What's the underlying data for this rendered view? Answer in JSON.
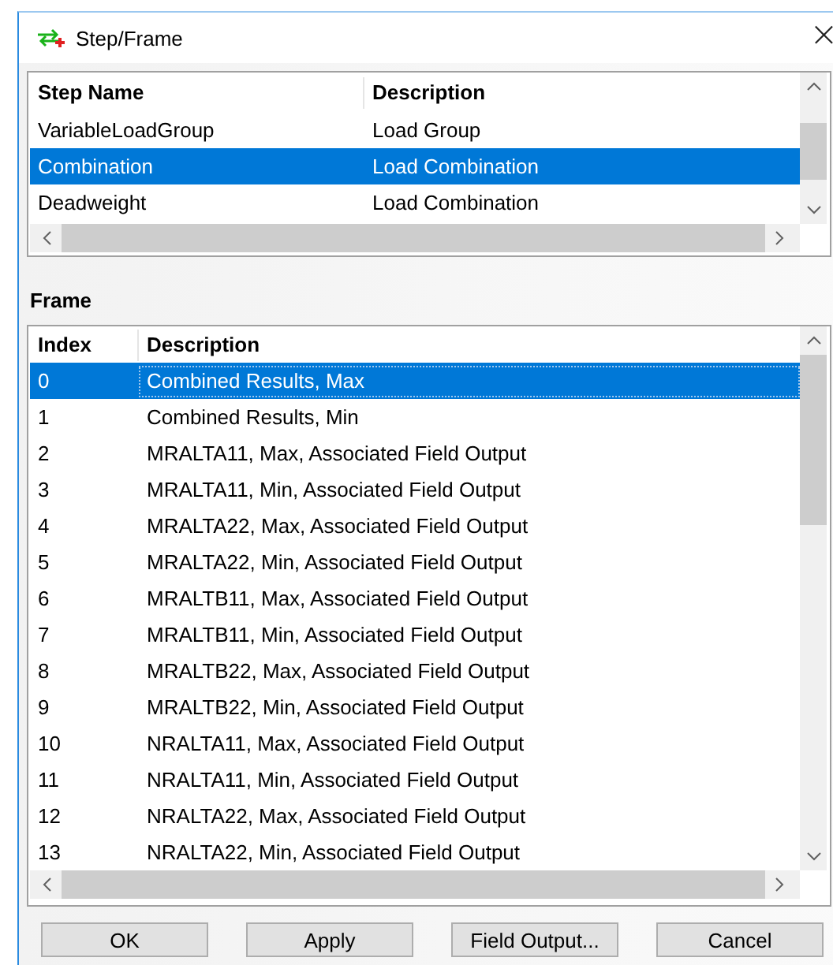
{
  "window": {
    "title": "Step/Frame",
    "close": "×"
  },
  "step_table": {
    "columns": [
      "Step Name",
      "Description"
    ],
    "rows": [
      {
        "cells": [
          "VariableLoadGroup",
          "Load Group"
        ],
        "selected": false
      },
      {
        "cells": [
          "Combination",
          "Load Combination"
        ],
        "selected": true
      },
      {
        "cells": [
          "Deadweight",
          "Load Combination"
        ],
        "selected": false
      }
    ]
  },
  "frame_section": {
    "label": "Frame"
  },
  "frame_table": {
    "columns": [
      "Index",
      "Description"
    ],
    "rows": [
      {
        "cells": [
          "0",
          "Combined Results, Max"
        ],
        "selected": true
      },
      {
        "cells": [
          "1",
          "Combined Results, Min"
        ],
        "selected": false
      },
      {
        "cells": [
          "2",
          "MRALTA11, Max, Associated Field Output"
        ],
        "selected": false
      },
      {
        "cells": [
          "3",
          "MRALTA11, Min, Associated Field Output"
        ],
        "selected": false
      },
      {
        "cells": [
          "4",
          "MRALTA22, Max, Associated Field Output"
        ],
        "selected": false
      },
      {
        "cells": [
          "5",
          "MRALTA22, Min, Associated Field Output"
        ],
        "selected": false
      },
      {
        "cells": [
          "6",
          "MRALTB11, Max, Associated Field Output"
        ],
        "selected": false
      },
      {
        "cells": [
          "7",
          "MRALTB11, Min, Associated Field Output"
        ],
        "selected": false
      },
      {
        "cells": [
          "8",
          "MRALTB22, Max, Associated Field Output"
        ],
        "selected": false
      },
      {
        "cells": [
          "9",
          "MRALTB22, Min, Associated Field Output"
        ],
        "selected": false
      },
      {
        "cells": [
          "10",
          "NRALTA11, Max, Associated Field Output"
        ],
        "selected": false
      },
      {
        "cells": [
          "11",
          "NRALTA11, Min, Associated Field Output"
        ],
        "selected": false
      },
      {
        "cells": [
          "12",
          "NRALTA22, Max, Associated Field Output"
        ],
        "selected": false
      },
      {
        "cells": [
          "13",
          "NRALTA22, Min, Associated Field Output"
        ],
        "selected": false
      }
    ]
  },
  "buttons": [
    "OK",
    "Apply",
    "Field Output...",
    "Cancel"
  ]
}
